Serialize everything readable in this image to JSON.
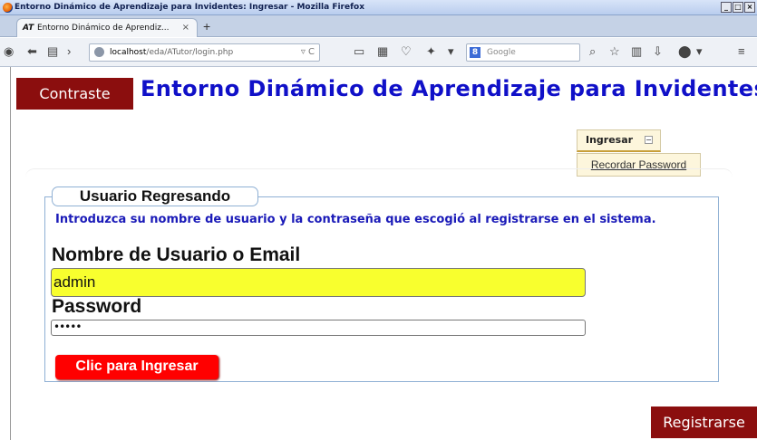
{
  "window": {
    "title": "Entorno Dinámico de Aprendizaje para Invidentes: Ingresar - Mozilla Firefox",
    "buttons": [
      "_",
      "□",
      "×"
    ]
  },
  "tabs": [
    {
      "icon_text": "AT",
      "label": "Entorno Dinámico de Aprendiz...",
      "close": "×"
    }
  ],
  "new_tab": "+",
  "navbar": {
    "url_host": "localhost",
    "url_path": "/eda/ATutor/login.php",
    "url_controls": "▿ C",
    "search_engine_icon": "8",
    "search_placeholder": "Google",
    "search_icon": "⌕"
  },
  "header": {
    "contrast_button": "Contraste",
    "site_title": "Entorno Dinámico de Aprendizaje para Invidentes"
  },
  "side_menu": {
    "active_tab": "Ingresar",
    "collapse_icon": "−",
    "items": [
      "Recordar Password"
    ]
  },
  "login_form": {
    "legend": "Usuario Regresando",
    "instructions": "Introduzca su nombre de usuario y la contraseña que escogió al registrarse en el sistema.",
    "username_label": "Nombre de Usuario o Email",
    "username_value": "admin",
    "password_label": "Password",
    "password_value": "•••••",
    "submit_label": "Clic para Ingresar"
  },
  "footer": {
    "register_button": "Registrarse"
  },
  "colors": {
    "brand_dark_red": "#8b0e0e",
    "title_blue": "#1010c8",
    "submit_red": "#ff0000",
    "input_highlight": "#f8ff2e"
  }
}
